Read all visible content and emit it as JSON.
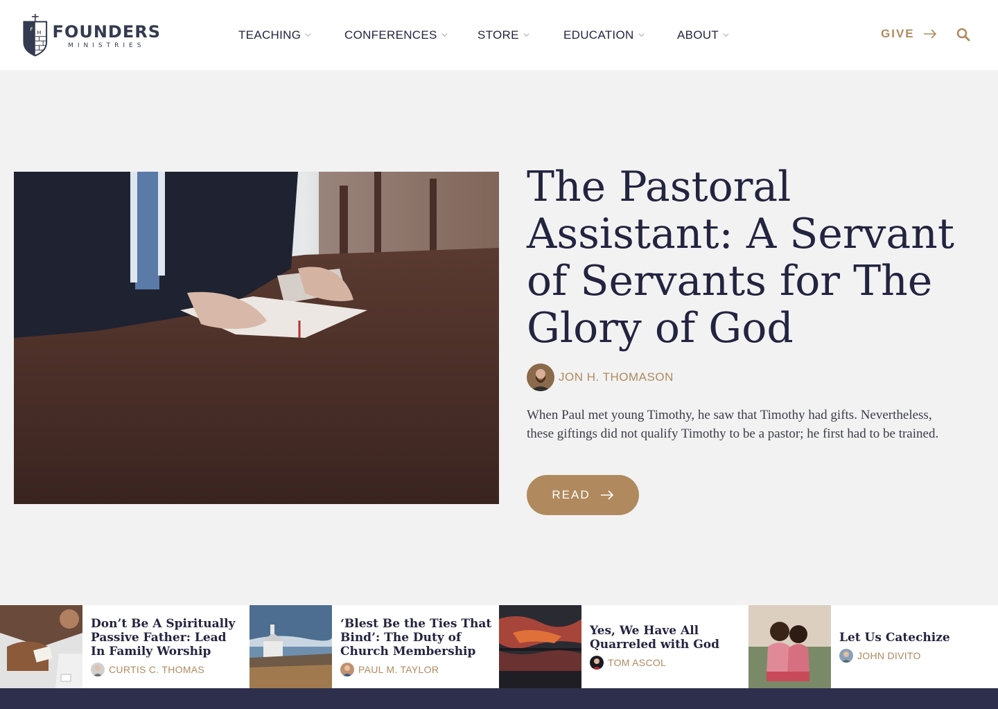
{
  "site": {
    "logo_title": "FOUNDERS",
    "logo_subtitle": "MINISTRIES",
    "logo_icon": "shield-logo-icon"
  },
  "nav": {
    "items": [
      {
        "label": "TEACHING"
      },
      {
        "label": "CONFERENCES"
      },
      {
        "label": "STORE"
      },
      {
        "label": "EDUCATION"
      },
      {
        "label": "ABOUT"
      }
    ],
    "give_label": "GIVE",
    "search_icon": "search-icon"
  },
  "hero": {
    "title": "The Pastoral Assistant: A Servant of Servants for The Glory of God",
    "author": "JON H. THOMASON",
    "excerpt": "When Paul met young Timothy, he saw that Timothy had gifts. Nevertheless, these giftings did not qualify Timothy to be a pastor; he first had to be trained.",
    "read_label": "READ"
  },
  "cards": [
    {
      "title": "Don’t Be A Spiritually Passive Father: Lead In Family Worship",
      "author": "CURTIS C. THOMAS"
    },
    {
      "title": "‘Blest Be the Ties That Bind’: The Duty of Church Membership",
      "author": "PAUL M. TAYLOR"
    },
    {
      "title": "Yes, We Have All Quarreled with God",
      "author": "TOM ASCOL"
    },
    {
      "title": "Let Us Catechize",
      "author": "JOHN DIVITO"
    }
  ],
  "colors": {
    "accent": "#b08a5e",
    "navy": "#232440",
    "background": "#f2f2f2",
    "footer": "#2e2f4d"
  }
}
